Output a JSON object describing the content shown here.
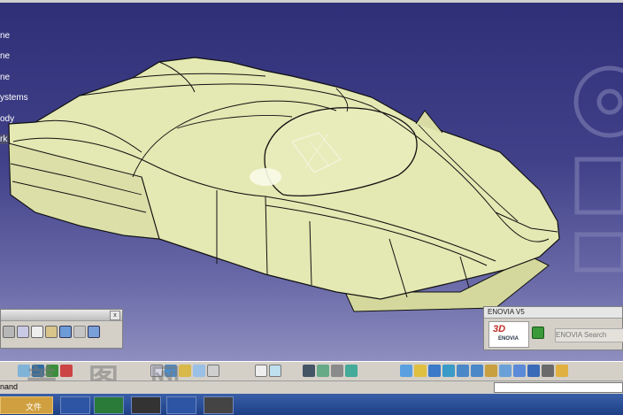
{
  "tree": {
    "items": [
      "ne",
      "ne",
      "ne",
      "ystems",
      "ody",
      "rk Red"
    ]
  },
  "enovia": {
    "title": "ENOVIA V5",
    "logo_text": "ENOVIA",
    "logo_prefix": "3D",
    "field_text": "ENOVIA Search"
  },
  "command_bar": {
    "label": "nand"
  },
  "watermark": "美 图 网",
  "taskbar": {
    "task_label": "文件"
  },
  "icons": [
    "print-icon",
    "cut-icon",
    "copy-icon",
    "paste-icon",
    "undo-icon",
    "redo-icon",
    "whats-this-icon",
    "measure-icon",
    "sketch-icon",
    "grid-icon",
    "formula-icon",
    "comment-icon",
    "table-icon",
    "tree-icon",
    "pan-icon",
    "fit-all-icon",
    "rotate-icon",
    "zoom-in-icon",
    "zoom-out-icon",
    "normal-view-icon",
    "multi-view-icon",
    "iso-view-icon",
    "shading-icon",
    "hide-show-icon",
    "swap-icon"
  ],
  "colors": {
    "background_top": "#2f2f78",
    "background_bottom": "#8e8ec0",
    "model_fill": "#e4e8b2",
    "model_edge": "#111111"
  }
}
